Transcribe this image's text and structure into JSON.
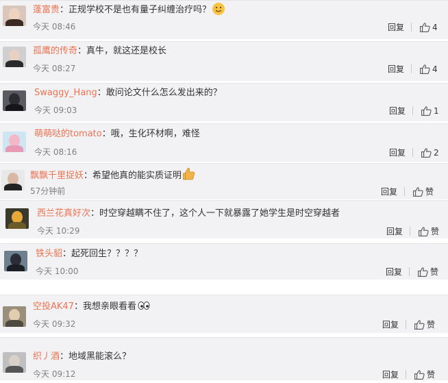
{
  "comments": [
    {
      "user": "蓬富贵",
      "text": "：正规学校不是也有量子纠缠治疗吗？",
      "emoji": "smiling-face-emoji",
      "time": "今天 08:46",
      "reply": "回复",
      "likes": "4"
    },
    {
      "user": "孤鹰的传奇",
      "text": "：真牛，就这还是校长",
      "time": "今天 08:27",
      "reply": "回复",
      "likes": "4"
    },
    {
      "user": "Swaggy_Hang",
      "text": "：敢问论文什么怎么发出来的？",
      "time": "今天 09:03",
      "reply": "回复",
      "likes": "1"
    },
    {
      "user": "萌萌哒的tomato",
      "text": "：哦，生化环材啊，难怪",
      "time": "今天 08:16",
      "reply": "回复",
      "likes": "2"
    },
    {
      "user": "飘飘千里捉妖",
      "text": "：希望他真的能实质证明",
      "emoji": "thumbs-up-emoji",
      "time": "57分钟前",
      "reply": "回复",
      "likes": "赞"
    },
    {
      "user": "西兰花真好次",
      "text": "：时空穿越瞒不住了，这个人一下就暴露了她学生是时空穿越者",
      "time": "今天 10:29",
      "reply": "回复",
      "likes": "赞"
    },
    {
      "user": "铁头貂",
      "text": "：起死回生？？？？",
      "time": "今天 10:00",
      "reply": "回复",
      "likes": "赞"
    },
    {
      "user": "空投AK47",
      "text": "：我想亲眼看看",
      "emoji": "eyes-emoji",
      "time": "今天 09:32",
      "reply": "回复",
      "likes": "赞"
    },
    {
      "user": "织丿酒",
      "text": "：地域黑能滚么？",
      "time": "今天 09:12",
      "reply": "回复",
      "likes": "赞"
    }
  ],
  "colors": {
    "username": "#eb7350",
    "text": "#333333",
    "time": "#808080",
    "row_background": "#f2f2f5"
  },
  "avatars": [
    {
      "name": "avatar-woman-face",
      "bg": "#d9c7bd",
      "head": "#f0d2c0",
      "body": "#3a2a22"
    },
    {
      "name": "avatar-girl-dark-hair",
      "bg": "#cfcfcf",
      "head": "#e8d0c2",
      "body": "#2b2b2b"
    },
    {
      "name": "avatar-hooded-figure",
      "bg": "#5a5a62",
      "head": "#2c2c30",
      "body": "#15151a"
    },
    {
      "name": "avatar-pink-anime",
      "bg": "#cfe6f2",
      "head": "#f3b8c8",
      "body": "#e79ab3"
    },
    {
      "name": "avatar-man-suit",
      "bg": "#e8e8e8",
      "head": "#d8b8a4",
      "body": "#222222"
    },
    {
      "name": "avatar-candle-flame",
      "bg": "#3b3a2a",
      "head": "#e7a83a",
      "body": "#6b5a2a"
    },
    {
      "name": "avatar-dark-character",
      "bg": "#6e7f8e",
      "head": "#2a2d35",
      "body": "#1b1e24"
    },
    {
      "name": "avatar-person-figure",
      "bg": "#9a8f7c",
      "head": "#e3cdb0",
      "body": "#4e4a40"
    },
    {
      "name": "avatar-gray-face",
      "bg": "#bfbfbf",
      "head": "#d9d1c9",
      "body": "#555555"
    }
  ]
}
